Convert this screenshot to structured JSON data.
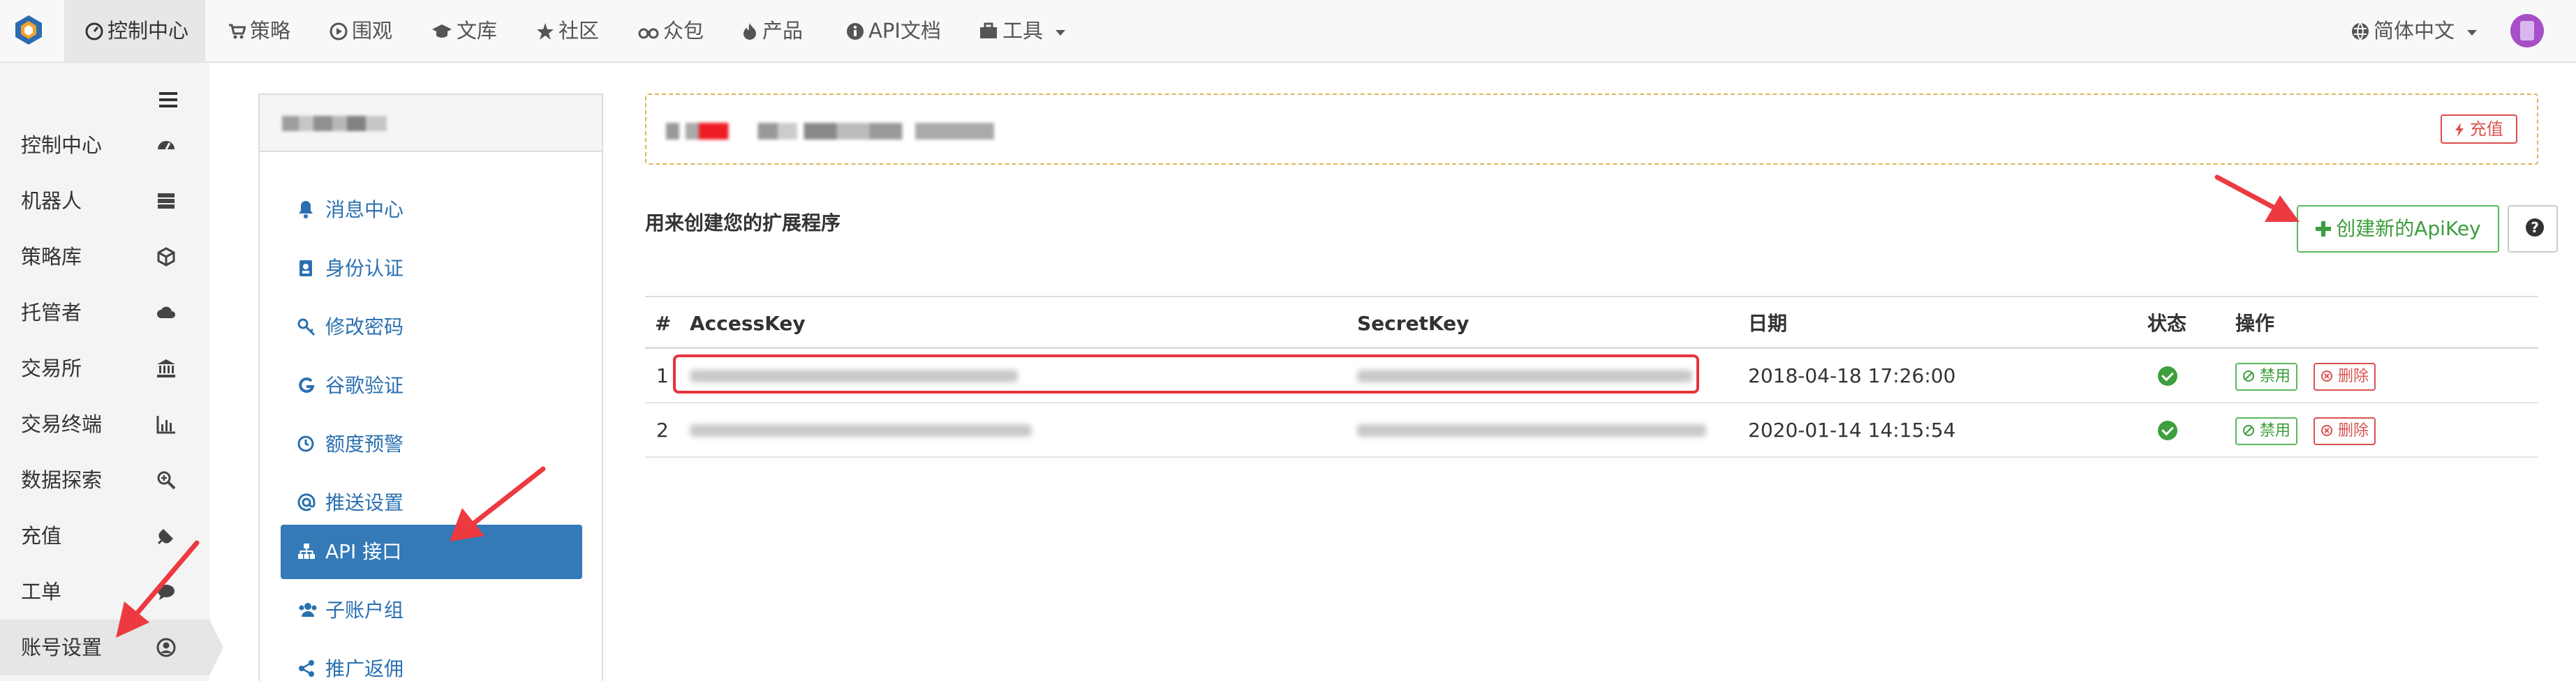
{
  "topnav": {
    "items": [
      {
        "label": "控制中心",
        "icon": "dashboard-icon",
        "active": true
      },
      {
        "label": "策略",
        "icon": "cart-icon"
      },
      {
        "label": "围观",
        "icon": "play-circle-icon"
      },
      {
        "label": "文库",
        "icon": "graduation-cap-icon"
      },
      {
        "label": "社区",
        "icon": "star-icon"
      },
      {
        "label": "众包",
        "icon": "binoculars-icon"
      },
      {
        "label": "产品",
        "icon": "fire-icon"
      },
      {
        "label": "API文档",
        "icon": "info-circle-icon"
      },
      {
        "label": "工具",
        "icon": "briefcase-icon"
      }
    ],
    "language": "简体中文"
  },
  "sidebar": {
    "items": [
      {
        "label": "控制中心",
        "icon": "dashboard-icon"
      },
      {
        "label": "机器人",
        "icon": "server-icon"
      },
      {
        "label": "策略库",
        "icon": "cube-icon"
      },
      {
        "label": "托管者",
        "icon": "cloud-icon"
      },
      {
        "label": "交易所",
        "icon": "bank-icon"
      },
      {
        "label": "交易终端",
        "icon": "bar-chart-icon"
      },
      {
        "label": "数据探索",
        "icon": "search-plus-icon"
      },
      {
        "label": "充值",
        "icon": "plug-icon"
      },
      {
        "label": "工单",
        "icon": "comments-icon"
      },
      {
        "label": "账号设置",
        "icon": "user-circle-icon",
        "active": true
      }
    ]
  },
  "settings_menu": {
    "items": [
      {
        "label": "消息中心",
        "icon": "bell-icon"
      },
      {
        "label": "身份认证",
        "icon": "id-badge-icon"
      },
      {
        "label": "修改密码",
        "icon": "key-icon"
      },
      {
        "label": "谷歌验证",
        "icon": "google-icon"
      },
      {
        "label": "额度预警",
        "icon": "clock-icon"
      },
      {
        "label": "推送设置",
        "icon": "at-icon"
      },
      {
        "label": "API 接口",
        "icon": "sitemap-icon",
        "active": true
      },
      {
        "label": "子账户组",
        "icon": "users-icon"
      },
      {
        "label": "推广返佣",
        "icon": "share-icon"
      }
    ]
  },
  "notice": {
    "recharge_label": "充值"
  },
  "main": {
    "description": "用来创建您的扩展程序",
    "create_label": "创建新的ApiKey"
  },
  "table": {
    "headers": [
      "#",
      "AccessKey",
      "SecretKey",
      "日期",
      "状态",
      "操作"
    ],
    "rows": [
      {
        "index": "1",
        "date": "2018-04-18 17:26:00",
        "disable_label": "禁用",
        "delete_label": "删除"
      },
      {
        "index": "2",
        "date": "2020-01-14 14:15:54",
        "disable_label": "禁用",
        "delete_label": "删除"
      }
    ]
  },
  "colors": {
    "primary": "#337ab7",
    "success": "#5cb85c",
    "danger": "#d9534f",
    "annotation": "#e5343c"
  }
}
